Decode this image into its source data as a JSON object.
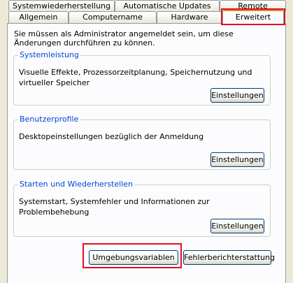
{
  "tabs_row1": [
    "Systemwiederherstellung",
    "Automatische Updates",
    "Remote"
  ],
  "tabs_row2": [
    "Allgemein",
    "Computername",
    "Hardware",
    "Erweitert"
  ],
  "active_tab": "Erweitert",
  "intro_text": "Sie müssen als Administrator angemeldet sein, um diese Änderungen durchführen zu können.",
  "groups": [
    {
      "title": "Systemleistung",
      "text": "Visuelle Effekte, Prozessorzeitplanung, Speichernutzung und virtueller Speicher",
      "button": "Einstellungen"
    },
    {
      "title": "Benutzerprofile",
      "text": "Desktopeinstellungen bezüglich der Anmeldung",
      "button": "Einstellungen"
    },
    {
      "title": "Starten und Wiederherstellen",
      "text": "Systemstart, Systemfehler und Informationen zur Problembehebung",
      "button": "Einstellungen"
    }
  ],
  "bottom_buttons": {
    "env_vars": "Umgebungsvariablen",
    "error_reporting": "Fehlerberichterstattung"
  },
  "colors": {
    "window_bg": "#ece9d8",
    "panel_bg": "#fcfcfe",
    "legend_text": "#0046d5",
    "active_tab_accent": "#e68b2c",
    "highlight": "#e0101e"
  }
}
